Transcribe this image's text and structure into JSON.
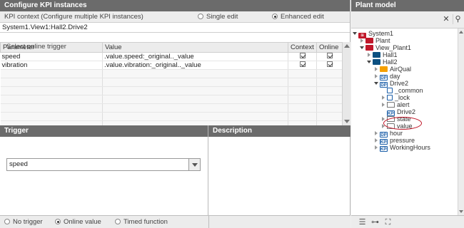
{
  "left_panel": {
    "title": "Configure KPI instances",
    "context_label": "KPI context (Configure multiple KPI instances)",
    "mode_single": "Single edit",
    "mode_enhanced": "Enhanced edit",
    "selected_mode": "Enhanced edit",
    "path": "System1.View1:Hall2.Drive2",
    "table": {
      "columns": [
        "Parameter",
        "Value",
        "Context",
        "Online"
      ],
      "rows": [
        {
          "parameter": "speed",
          "value": ".value.speed:_original.._value",
          "context": true,
          "online": true
        },
        {
          "parameter": "vibration",
          "value": ".value.vibration:_original.._value",
          "context": true,
          "online": true
        }
      ]
    },
    "trigger": {
      "title": "Trigger",
      "select_label": "Select online trigger",
      "selected": "speed"
    },
    "description": {
      "title": "Description"
    },
    "footer": {
      "no_trigger": "No trigger",
      "online_value": "Online value",
      "timed_function": "Timed function",
      "selected": "Online value"
    }
  },
  "right_panel": {
    "title": "Plant model",
    "tree": [
      {
        "label": "System1",
        "icon": "system-icon"
      },
      {
        "label": "Plant",
        "icon": "plant-icon"
      },
      {
        "label": "View_Plant1",
        "icon": "view-icon"
      },
      {
        "label": "Hall1",
        "icon": "hall-icon"
      },
      {
        "label": "Hall2",
        "icon": "hall-icon"
      },
      {
        "label": "AirQual",
        "icon": "air-quality-icon"
      },
      {
        "label": "day",
        "icon": "datapoint-icon",
        "icon_text": "DP"
      },
      {
        "label": "Drive2",
        "icon": "datapoint-icon",
        "icon_text": "DP"
      },
      {
        "label": "_common",
        "icon": "document-icon"
      },
      {
        "label": "_lock",
        "icon": "document-icon"
      },
      {
        "label": "alert",
        "icon": "folder-icon"
      },
      {
        "label": "Drive2",
        "icon": "kpi-icon",
        "icon_text": "KPI",
        "highlighted": true
      },
      {
        "label": "state",
        "icon": "folder-icon"
      },
      {
        "label": "value",
        "icon": "folder-icon"
      },
      {
        "label": "hour",
        "icon": "datapoint-icon",
        "icon_text": "DP"
      },
      {
        "label": "pressure",
        "icon": "kpi-icon",
        "icon_text": "KPI"
      },
      {
        "label": "WorkingHours",
        "icon": "kpi-icon",
        "icon_text": "KPI"
      }
    ]
  },
  "colors": {
    "header_bg": "#6b6b6b",
    "highlight_ring": "#c0182a",
    "system_red": "#c0182a",
    "hall_blue": "#0c5080",
    "air_orange": "#f5a000",
    "kpi_blue": "#1b5ea8"
  }
}
